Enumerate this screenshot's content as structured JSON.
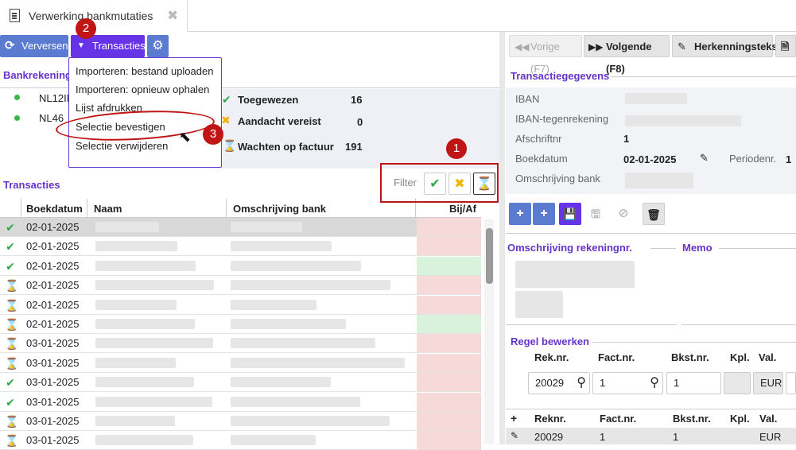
{
  "tab": {
    "title": "Verwerking bankmutaties"
  },
  "toolbar": {
    "refresh_label": "Verversen",
    "transactions_label": "Transacties"
  },
  "dropdown": {
    "items": [
      "Importeren: bestand uploaden",
      "Importeren: opnieuw ophalen",
      "Lijst afdrukken",
      "Selectie bevestigen",
      "Selectie verwijderen"
    ]
  },
  "markers": {
    "m1": "1",
    "m2": "2",
    "m3": "3"
  },
  "bank": {
    "title": "Bankrekeningen",
    "accounts": [
      {
        "iban": "NL12IN"
      },
      {
        "iban": "NL46"
      }
    ]
  },
  "summary": {
    "assigned_label": "Toegewezen",
    "assigned_count": "16",
    "attention_label": "Aandacht vereist",
    "attention_count": "0",
    "waiting_label": "Wachten op factuur",
    "waiting_count": "191"
  },
  "transactions": {
    "title": "Transacties",
    "filter_label": "Filter",
    "columns": [
      "Boekdatum",
      "Naam",
      "Omschrijving bank",
      "Bij/Af"
    ],
    "rows": [
      {
        "status": "check",
        "date": "02-01-2025"
      },
      {
        "status": "check",
        "date": "02-01-2025"
      },
      {
        "status": "check",
        "date": "02-01-2025"
      },
      {
        "status": "hour",
        "date": "02-01-2025"
      },
      {
        "status": "hour",
        "date": "02-01-2025"
      },
      {
        "status": "hour",
        "date": "02-01-2025"
      },
      {
        "status": "hour",
        "date": "03-01-2025"
      },
      {
        "status": "hour",
        "date": "03-01-2025"
      },
      {
        "status": "check",
        "date": "03-01-2025"
      },
      {
        "status": "check",
        "date": "03-01-2025"
      },
      {
        "status": "hour",
        "date": "03-01-2025"
      },
      {
        "status": "hour",
        "date": "03-01-2025"
      }
    ]
  },
  "nav": {
    "prev_label": "Vorige (F7)",
    "next_label": "Volgende (F8)",
    "recognition_label": "Herkenningstekst"
  },
  "details": {
    "title": "Transactiegegevens",
    "iban_label": "IBAN",
    "iban_counter_label": "IBAN-tegenrekening",
    "statement_label": "Afschriftnr",
    "statement_value": "1",
    "bookdate_label": "Boekdatum",
    "bookdate_value": "02-01-2025",
    "period_label": "Periodenr.",
    "period_value": "1",
    "bank_desc_label": "Omschrijving bank"
  },
  "account_desc": {
    "title": "Omschrijving rekeningnr.",
    "memo_title": "Memo"
  },
  "edit_line": {
    "title": "Regel bewerken",
    "columns": [
      "Rek.nr.",
      "Fact.nr.",
      "Bkst.nr.",
      "Kpl.",
      "Val."
    ],
    "account_value": "20029",
    "invoice_value": "1",
    "doc_value": "1",
    "kpl_value": "",
    "currency_value": "EUR",
    "table_columns": [
      "Reknr.",
      "Fact.nr.",
      "Bkst.nr.",
      "Kpl.",
      "Val."
    ],
    "table_row": {
      "account": "20029",
      "invoice": "1",
      "doc": "1",
      "currency": "EUR"
    }
  },
  "colors": {
    "purple": "#6633e6",
    "blue": "#5b7bd0",
    "highlight": "#c01515"
  }
}
